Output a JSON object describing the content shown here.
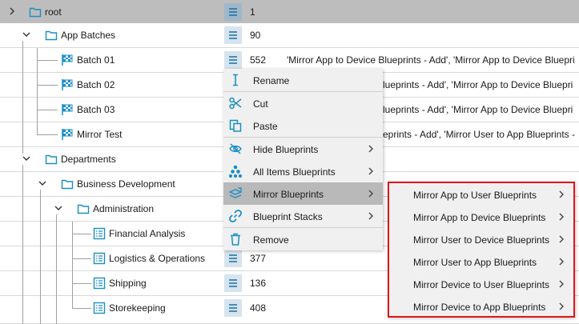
{
  "tree": {
    "rows": [
      {
        "label": "root",
        "count": "1",
        "desc": ""
      },
      {
        "label": "App Batches",
        "count": "90",
        "desc": ""
      },
      {
        "label": "Batch 01",
        "count": "552",
        "desc": "'Mirror App to Device Blueprints - Add', 'Mirror App to Device Bluepri"
      },
      {
        "label": "Batch 02",
        "count": "",
        "desc": "lueprints - Add', 'Mirror App to Device Bluepri"
      },
      {
        "label": "Batch 03",
        "count": "",
        "desc": "lueprints - Add', 'Mirror App to Device Bluepri"
      },
      {
        "label": "Mirror Test",
        "count": "",
        "desc": "eprints - Add', 'Mirror User to App Blueprints -"
      },
      {
        "label": "Departments",
        "count": "",
        "desc": ""
      },
      {
        "label": "Business Development",
        "count": "",
        "desc": ""
      },
      {
        "label": "Administration",
        "count": "",
        "desc": ""
      },
      {
        "label": "Financial Analysis",
        "count": "",
        "desc": ""
      },
      {
        "label": "Logistics & Operations",
        "count": "377",
        "desc": ""
      },
      {
        "label": "Shipping",
        "count": "136",
        "desc": ""
      },
      {
        "label": "Storekeeping",
        "count": "408",
        "desc": ""
      }
    ]
  },
  "context_menu": {
    "items": [
      {
        "label": "Rename",
        "icon": "text-cursor-icon",
        "submenu": false
      },
      {
        "label": "Cut",
        "icon": "scissors-icon",
        "submenu": false
      },
      {
        "label": "Paste",
        "icon": "paste-icon",
        "submenu": false
      },
      {
        "label": "Hide Blueprints",
        "icon": "eye-off-icon",
        "submenu": true
      },
      {
        "label": "All Items Blueprints",
        "icon": "hierarchy-icon",
        "submenu": true
      },
      {
        "label": "Mirror Blueprints",
        "icon": "mirror-icon",
        "submenu": true
      },
      {
        "label": "Blueprint Stacks",
        "icon": "link-icon",
        "submenu": true
      },
      {
        "label": "Remove",
        "icon": "trash-icon",
        "submenu": false
      }
    ]
  },
  "submenu": {
    "items": [
      {
        "label": "Mirror App to User Blueprints"
      },
      {
        "label": "Mirror App to Device Blueprints"
      },
      {
        "label": "Mirror User to Device Blueprints"
      },
      {
        "label": "Mirror User to App Blueprints"
      },
      {
        "label": "Mirror Device to User Blueprints"
      },
      {
        "label": "Mirror Device to App Blueprints"
      }
    ]
  },
  "colors": {
    "accent": "#1a8fc4",
    "header_bg": "#bdbdbd",
    "menu_bg": "#f0f0f0",
    "menu_active": "#b9b9b9",
    "highlight_border": "#e0161b"
  }
}
